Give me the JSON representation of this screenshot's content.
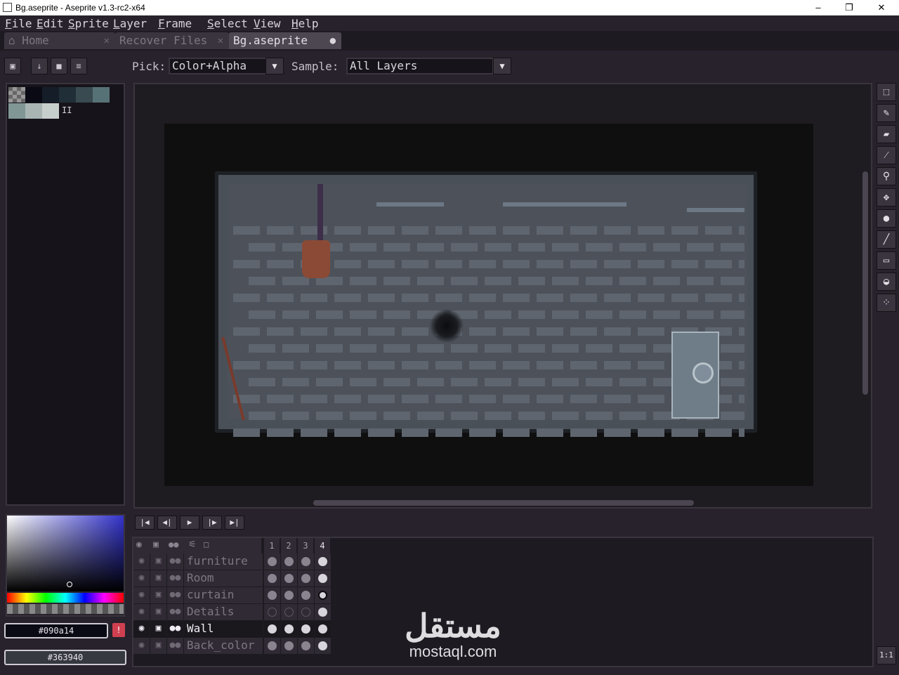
{
  "window": {
    "title": "Bg.aseprite - Aseprite v1.3-rc2-x64",
    "minimize": "–",
    "maximize": "❐",
    "close": "✕"
  },
  "menu": {
    "items": [
      {
        "first": "F",
        "rest": "ile"
      },
      {
        "first": "E",
        "rest": "dit"
      },
      {
        "first": "S",
        "rest": "prite"
      },
      {
        "first": "L",
        "rest": "ayer"
      },
      {
        "first": "F",
        "rest": "rame"
      },
      {
        "first": "S",
        "rest": "elect"
      },
      {
        "first": "V",
        "rest": "iew"
      },
      {
        "first": "H",
        "rest": "elp"
      }
    ]
  },
  "tabs": [
    {
      "label": "Home",
      "icon": "home-icon"
    },
    {
      "label": "Recover Files"
    },
    {
      "label": "Bg.aseprite",
      "modified": true
    }
  ],
  "context_bar": {
    "pick_label": "Pick:",
    "pick_value": "Color+Alpha",
    "sample_label": "Sample:",
    "sample_value": "All Layers"
  },
  "palette": {
    "colors": [
      "#090a14",
      "#151d28",
      "#202e37",
      "#394a50",
      "#577277",
      "#819796",
      "#a8b5b2",
      "#c7cfcc"
    ],
    "icon_label": "II"
  },
  "color_bar": {
    "foreground_hex": "#090a14",
    "background_hex": "#363940",
    "warning": "!"
  },
  "tools": [
    "rectangular-marquee-icon",
    "pencil-icon",
    "eraser-icon",
    "eyedropper-icon",
    "zoom-icon",
    "move-icon",
    "paint-bucket-icon",
    "line-icon",
    "rectangle-icon",
    "blur-icon",
    "spray-icon"
  ],
  "zoom_button": "1:1",
  "timeline": {
    "frames": [
      "1",
      "2",
      "3",
      "4"
    ],
    "layers": [
      {
        "name": "furniture",
        "cels": [
          "cel",
          "cel",
          "cel",
          "full"
        ]
      },
      {
        "name": "Room",
        "cels": [
          "cel",
          "cel",
          "cel",
          "full"
        ]
      },
      {
        "name": "curtain",
        "cels": [
          "cel",
          "cel",
          "cel",
          "ring"
        ]
      },
      {
        "name": "Details",
        "cels": [
          "empty",
          "empty",
          "empty",
          "full"
        ]
      },
      {
        "name": "Wall",
        "cels": [
          "full",
          "full",
          "full",
          "full"
        ],
        "selected": true
      },
      {
        "name": "Back_color",
        "cels": [
          "cel",
          "cel",
          "cel",
          "full"
        ]
      }
    ]
  },
  "watermark": {
    "arabic": "مستقل",
    "latin": "mostaql.com"
  }
}
